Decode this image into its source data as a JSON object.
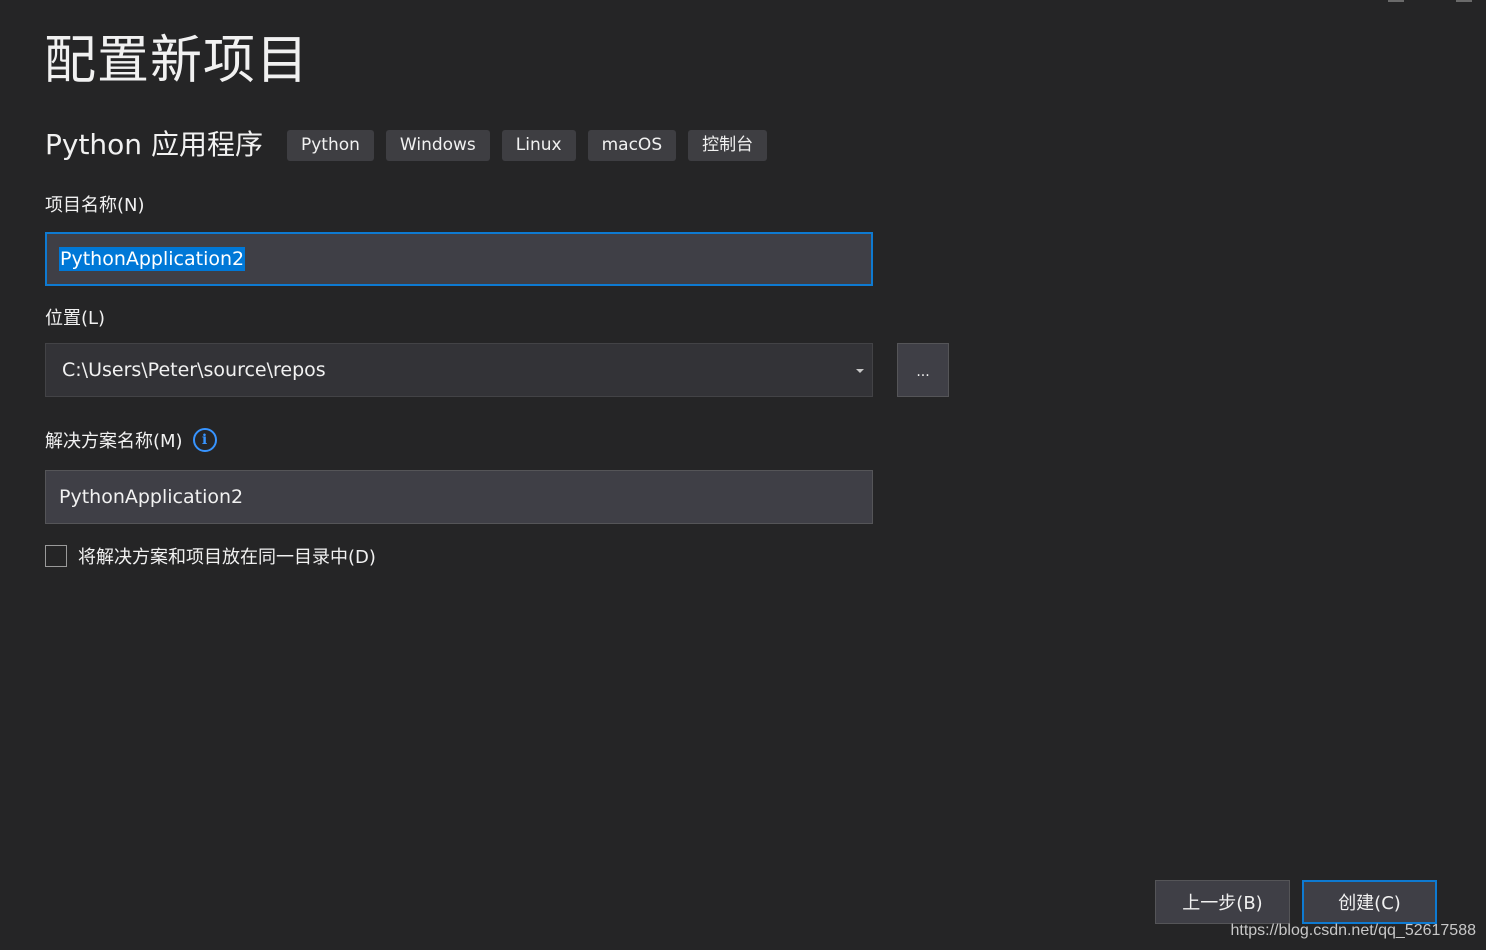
{
  "page": {
    "title": "配置新项目"
  },
  "template": {
    "name": "Python 应用程序",
    "tags": [
      "Python",
      "Windows",
      "Linux",
      "macOS",
      "控制台"
    ]
  },
  "project_name": {
    "label": "项目名称(N)",
    "value": "PythonApplication2"
  },
  "location": {
    "label": "位置(L)",
    "value": "C:\\Users\\Peter\\source\\repos",
    "browse_label": "..."
  },
  "solution_name": {
    "label": "解决方案名称(M)",
    "info_glyph": "i",
    "value": "PythonApplication2"
  },
  "same_directory": {
    "label": "将解决方案和项目放在同一目录中(D)",
    "checked": false
  },
  "buttons": {
    "back": "上一步(B)",
    "create": "创建(C)"
  },
  "watermark": "https://blog.csdn.net/qq_52617588",
  "colors": {
    "background": "#252526",
    "input_background": "#3f3f46",
    "accent": "#0e7ad1",
    "selection": "#0078d7",
    "info": "#3794ff"
  }
}
